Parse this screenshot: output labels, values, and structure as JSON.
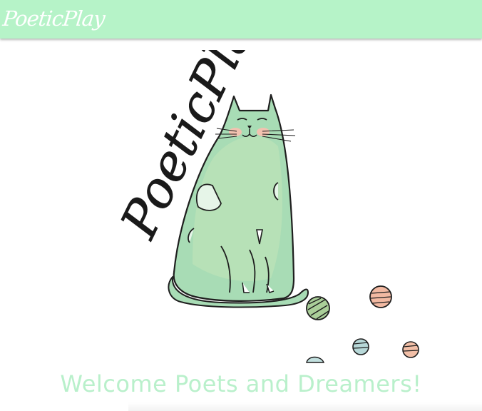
{
  "header": {
    "brand": "PoeticPlay",
    "background": "#b6f3c8"
  },
  "hero": {
    "logo_text": "PoeticPlay",
    "cat_color": "#9dd6ad"
  },
  "main": {
    "welcome": "Welcome Poets and Dreamers!",
    "welcome_color": "#b9f0cb"
  }
}
